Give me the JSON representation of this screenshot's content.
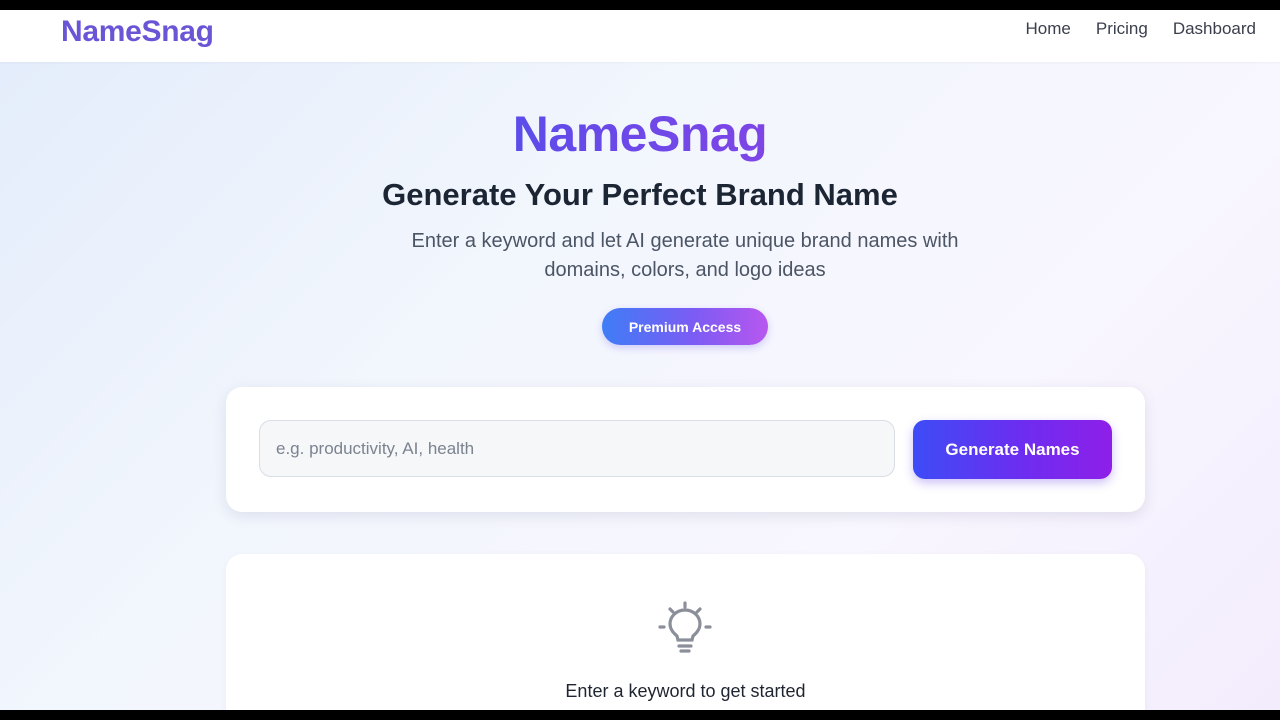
{
  "navbar": {
    "brand": "NameSnag",
    "links": [
      {
        "label": "Home"
      },
      {
        "label": "Pricing"
      },
      {
        "label": "Dashboard"
      }
    ]
  },
  "hero": {
    "logo_text": "NameSnag",
    "title": "Generate Your Perfect Brand Name",
    "subtitle": "Enter a keyword and let AI generate unique brand names with domains, colors, and logo ideas",
    "premium_label": "Premium Access"
  },
  "search": {
    "placeholder": "e.g. productivity, AI, health",
    "value": "",
    "button_label": "Generate Names"
  },
  "empty_state": {
    "icon": "lightbulb-icon",
    "message": "Enter a keyword to get started"
  },
  "colors": {
    "brand": "#6a55d6",
    "accent_start": "#3d4cf6",
    "accent_end": "#8e1fe8"
  }
}
